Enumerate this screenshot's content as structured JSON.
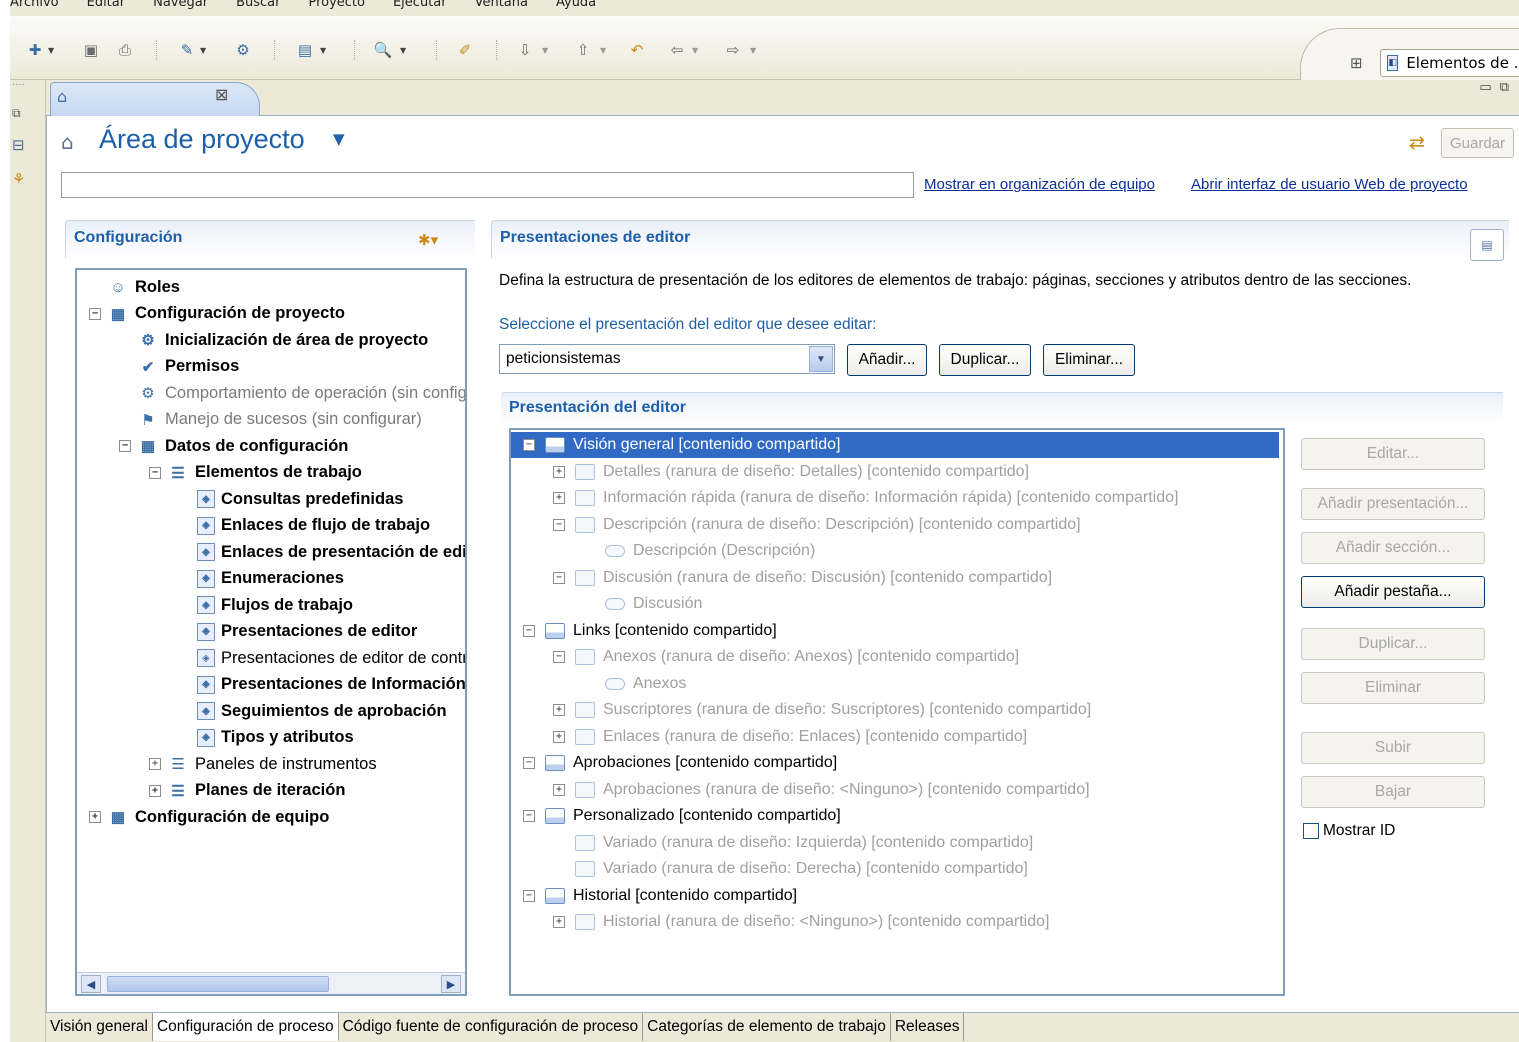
{
  "menubar": [
    "Archivo",
    "Editar",
    "Navegar",
    "Buscar",
    "Proyecto",
    "Ejecutar",
    "Ventana",
    "Ayuda"
  ],
  "perspective": {
    "label": "Elementos de ...",
    "icon": "perspective-icon"
  },
  "editor_tab": {
    "icon": "project-area-icon",
    "close_icon": "close-icon"
  },
  "header": {
    "title": "Área de proyecto",
    "save_label": "Guardar",
    "description_value": "",
    "link_team_org": "Mostrar en organización de equipo",
    "link_web_ui": "Abrir interfaz de usuario Web de proyecto"
  },
  "config": {
    "title": "Configuración",
    "tree": [
      {
        "label": "Roles",
        "bold": true,
        "icon": "roles-icon"
      },
      {
        "label": "Configuración de proyecto",
        "bold": true,
        "expander": "−",
        "icon": "project-config-icon"
      },
      {
        "label": "Inicialización de área de proyecto",
        "bold": true,
        "icon": "init-icon"
      },
      {
        "label": "Permisos",
        "bold": true,
        "icon": "permissions-icon"
      },
      {
        "label": "Comportamiento de operación (sin configurar)",
        "bold": false,
        "grey": true,
        "icon": "operation-icon"
      },
      {
        "label": "Manejo de sucesos (sin configurar)",
        "bold": false,
        "grey": true,
        "icon": "events-icon"
      },
      {
        "label": "Datos de configuración",
        "bold": true,
        "expander": "−",
        "icon": "config-data-icon"
      },
      {
        "label": "Elementos de trabajo",
        "bold": true,
        "expander": "−",
        "icon": "work-items-icon"
      },
      {
        "label": "Consultas predefinidas",
        "bold": true,
        "icon": "work-item-icon"
      },
      {
        "label": "Enlaces de flujo de trabajo",
        "bold": true,
        "icon": "work-item-icon"
      },
      {
        "label": "Enlaces de presentación de editor",
        "bold": true,
        "icon": "work-item-icon"
      },
      {
        "label": "Enumeraciones",
        "bold": true,
        "icon": "work-item-icon"
      },
      {
        "label": "Flujos de trabajo",
        "bold": true,
        "icon": "work-item-icon"
      },
      {
        "label": "Presentaciones de editor",
        "bold": true,
        "icon": "work-item-icon",
        "selected": true
      },
      {
        "label": "Presentaciones de editor de contribuyente",
        "bold": false,
        "icon": "work-item-icon"
      },
      {
        "label": "Presentaciones de Información rápida",
        "bold": true,
        "icon": "work-item-icon"
      },
      {
        "label": "Seguimientos de aprobación",
        "bold": true,
        "icon": "work-item-icon"
      },
      {
        "label": "Tipos y atributos",
        "bold": true,
        "icon": "work-item-icon"
      },
      {
        "label": "Paneles de instrumentos",
        "bold": false,
        "expander": "+",
        "icon": "dashboards-icon"
      },
      {
        "label": "Planes de iteración",
        "bold": true,
        "expander": "+",
        "icon": "iteration-plans-icon"
      },
      {
        "label": "Configuración de equipo",
        "bold": true,
        "expander": "+",
        "icon": "team-config-icon"
      }
    ]
  },
  "presentations": {
    "title": "Presentaciones de editor",
    "description": "Defina la estructura de presentación de los editores de elementos de trabajo: páginas, secciones y atributos dentro de las secciones.",
    "select_label": "Seleccione el presentación del editor que desee editar:",
    "selected_value": "peticionsistemas",
    "add_label": "Añadir...",
    "duplicate_label": "Duplicar...",
    "delete_label": "Eliminar...",
    "layout_title": "Presentación del editor",
    "layout_tree": [
      {
        "label": "Visión general [contenido compartido]",
        "expander": "−",
        "type": "page",
        "selected": true
      },
      {
        "label": "Detalles (ranura de diseño: Detalles) [contenido compartido]",
        "expander": "+",
        "type": "section",
        "grey": true
      },
      {
        "label": "Información rápida (ranura de diseño: Información rápida) [contenido compartido]",
        "expander": "+",
        "type": "section",
        "grey": true
      },
      {
        "label": "Descripción (ranura de diseño: Descripción) [contenido compartido]",
        "expander": "−",
        "type": "section",
        "grey": true
      },
      {
        "label": "Descripción (Descripción)",
        "type": "field",
        "grey": true
      },
      {
        "label": "Discusión (ranura de diseño: Discusión) [contenido compartido]",
        "expander": "−",
        "type": "section",
        "grey": true
      },
      {
        "label": "Discusión",
        "type": "field",
        "grey": true
      },
      {
        "label": "Links [contenido compartido]",
        "expander": "−",
        "type": "page"
      },
      {
        "label": "Anexos (ranura de diseño: Anexos) [contenido compartido]",
        "expander": "−",
        "type": "section",
        "grey": true
      },
      {
        "label": "Anexos",
        "type": "field",
        "grey": true
      },
      {
        "label": "Suscriptores (ranura de diseño: Suscriptores) [contenido compartido]",
        "expander": "+",
        "type": "section",
        "grey": true
      },
      {
        "label": "Enlaces (ranura de diseño: Enlaces) [contenido compartido]",
        "expander": "+",
        "type": "section",
        "grey": true
      },
      {
        "label": "Aprobaciones [contenido compartido]",
        "expander": "−",
        "type": "page"
      },
      {
        "label": "Aprobaciones (ranura de diseño: <Ninguno>) [contenido compartido]",
        "expander": "+",
        "type": "section",
        "grey": true
      },
      {
        "label": "Personalizado [contenido compartido]",
        "expander": "−",
        "type": "page"
      },
      {
        "label": "Variado (ranura de diseño: Izquierda) [contenido compartido]",
        "type": "section",
        "grey": true
      },
      {
        "label": "Variado (ranura de diseño: Derecha) [contenido compartido]",
        "type": "section",
        "grey": true
      },
      {
        "label": "Historial [contenido compartido]",
        "expander": "−",
        "type": "page"
      },
      {
        "label": "Historial (ranura de diseño: <Ninguno>) [contenido compartido]",
        "expander": "+",
        "type": "section",
        "grey": true
      }
    ],
    "side_buttons": [
      {
        "label": "Editar...",
        "enabled": false
      },
      {
        "label": "Añadir presentación...",
        "enabled": false
      },
      {
        "label": "Añadir sección...",
        "enabled": false
      },
      {
        "label": "Añadir pestaña...",
        "enabled": true
      },
      {
        "label": "Duplicar...",
        "enabled": false
      },
      {
        "label": "Eliminar",
        "enabled": false
      },
      {
        "label": "Subir",
        "enabled": false
      },
      {
        "label": "Bajar",
        "enabled": false
      }
    ],
    "show_id_label": "Mostrar ID"
  },
  "bottom_tabs": [
    "Visión general",
    "Configuración de proceso",
    "Código fuente de configuración de proceso",
    "Categorías de elemento de trabajo",
    "Releases"
  ],
  "bottom_active": 1
}
